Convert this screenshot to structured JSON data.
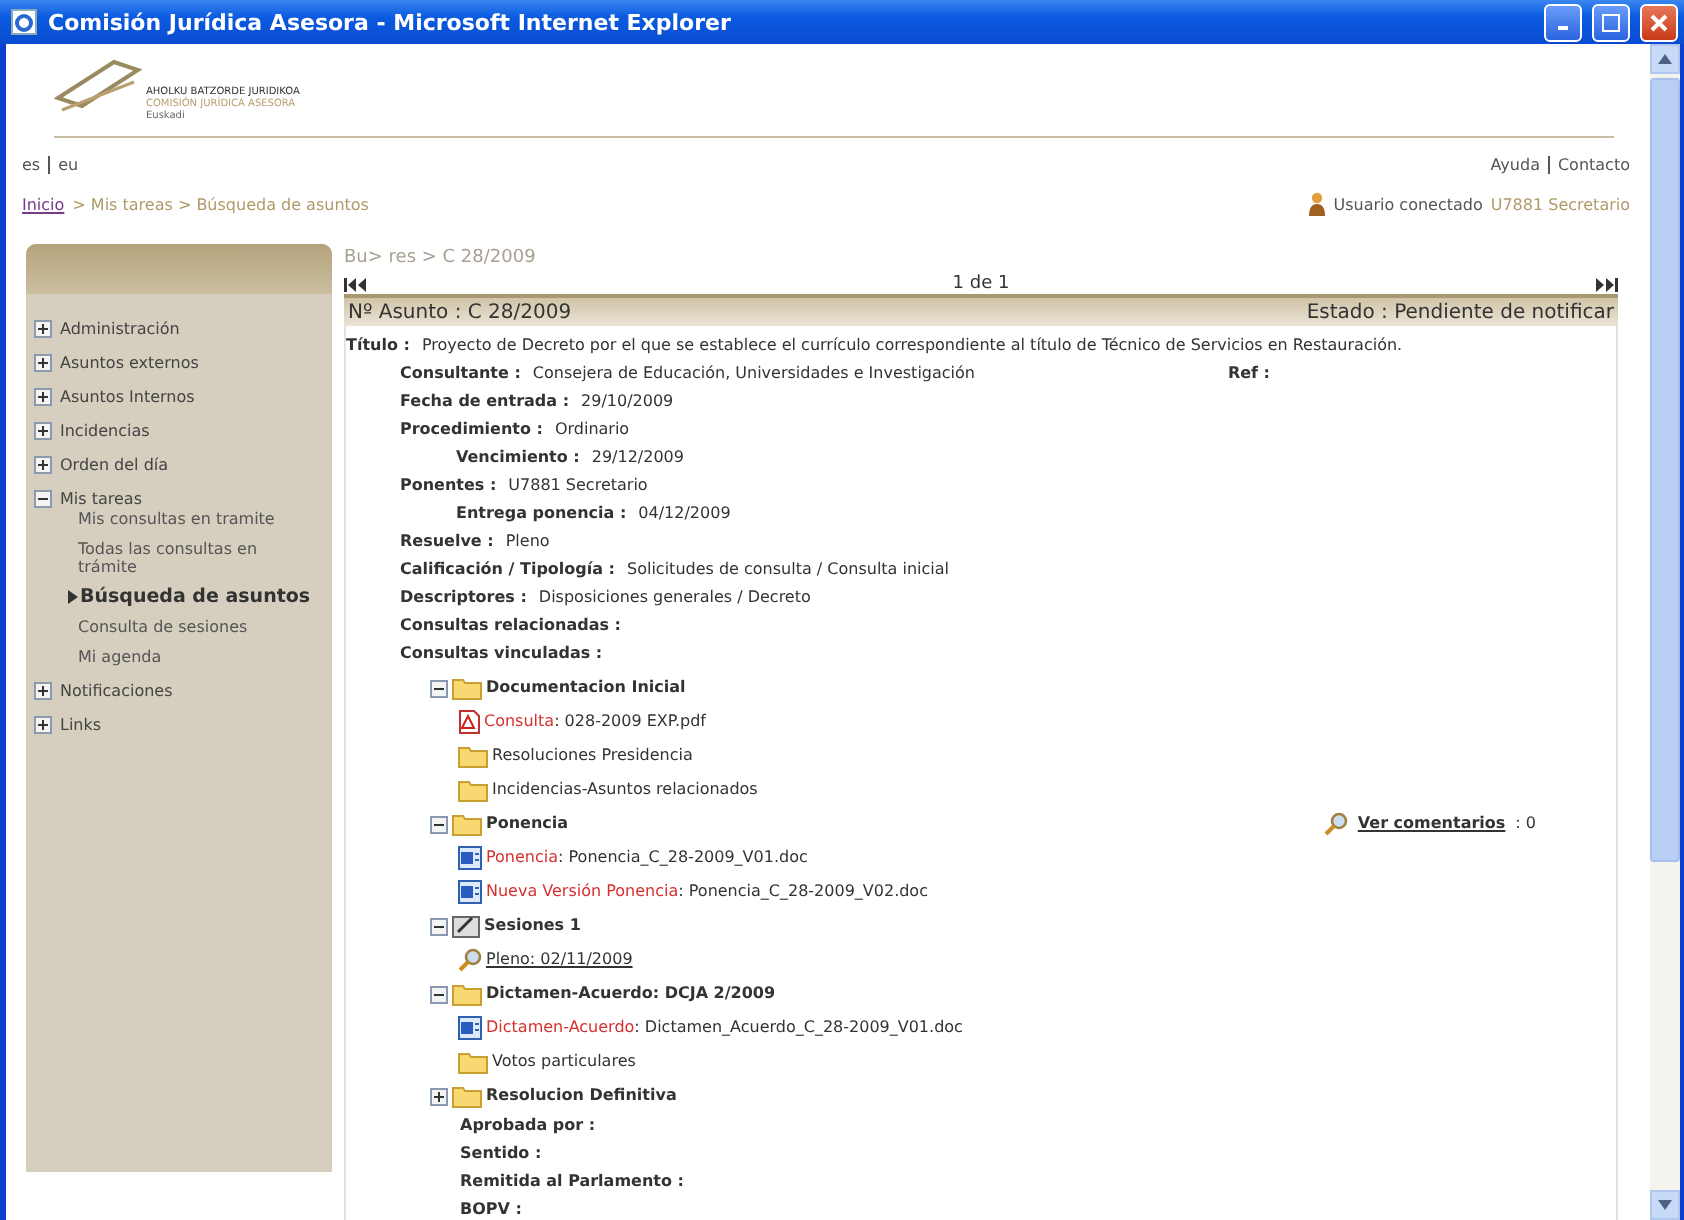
{
  "window": {
    "title": "Comisión Jurídica Asesora - Microsoft Internet Explorer"
  },
  "logo": {
    "lines": [
      "AHOLKU BATZORDE JURIDIKOA",
      "COMISIÓN JURÍDICA ASESORA",
      "Euskadi"
    ]
  },
  "languages": [
    "es",
    "eu"
  ],
  "top_links": [
    "Ayuda",
    "Contacto"
  ],
  "breadcrumb": {
    "home": "Inicio",
    "rest": "> Mis tareas > Búsqueda de asuntos"
  },
  "user": {
    "label": "Usuario conectado",
    "name": "U7881 Secretario"
  },
  "sidebar": {
    "items": [
      {
        "label": "Administración",
        "expanded": false
      },
      {
        "label": "Asuntos externos",
        "expanded": false
      },
      {
        "label": "Asuntos Internos",
        "expanded": false
      },
      {
        "label": "Incidencias",
        "expanded": false
      },
      {
        "label": "Orden del día",
        "expanded": false
      },
      {
        "label": "Mis tareas",
        "expanded": true,
        "children": [
          {
            "label": "Mis consultas en tramite",
            "selected": false
          },
          {
            "label": "Todas las consultas en trámite",
            "selected": false
          },
          {
            "label": "Búsqueda de asuntos",
            "selected": true
          },
          {
            "label": "Consulta de sesiones",
            "selected": false
          },
          {
            "label": "Mi agenda",
            "selected": false
          }
        ]
      },
      {
        "label": "Notificaciones",
        "expanded": false
      },
      {
        "label": "Links",
        "expanded": false
      }
    ]
  },
  "content": {
    "path": "Bu> res > C 28/2009",
    "pager": "1 de 1",
    "number": "Nº Asunto : C 28/2009",
    "status": "Estado : Pendiente de notificar",
    "title": {
      "label": "Título :",
      "value": "Proyecto de Decreto por el que se establece el currículo correspondiente al título de Técnico de Servicios en Restauración."
    },
    "fields": [
      {
        "label": "Consultante :",
        "value": "Consejera de Educación, Universidades e Investigación",
        "extra": "Ref :"
      },
      {
        "label": "Fecha de entrada :",
        "value": "29/10/2009"
      },
      {
        "label": "Procedimiento :",
        "value": "Ordinario",
        "children": [
          {
            "label": "Vencimiento :",
            "value": "29/12/2009"
          }
        ]
      },
      {
        "label": "Ponentes :",
        "value": "U7881 Secretario",
        "children": [
          {
            "label": "Entrega ponencia :",
            "value": "04/12/2009"
          }
        ]
      },
      {
        "label": "Resuelve :",
        "value": "Pleno"
      },
      {
        "label": "Calificación / Tipología :",
        "value": "Solicitudes de consulta / Consulta inicial"
      },
      {
        "label": "Descriptores :",
        "value": "Disposiciones generales / Decreto"
      },
      {
        "label": "Consultas relacionadas :"
      },
      {
        "label": "Consultas vinculadas :"
      }
    ],
    "tree": [
      {
        "kind": "folder",
        "label": "Documentacion Inicial",
        "expanded": true,
        "children": [
          {
            "kind": "pdf",
            "prefix": "Consulta",
            "name": ": 028-2009 EXP.pdf"
          },
          {
            "kind": "leaf",
            "label": "Resoluciones Presidencia"
          },
          {
            "kind": "leaf",
            "label": "Incidencias-Asuntos relacionados"
          }
        ]
      },
      {
        "kind": "folder",
        "label": "Ponencia",
        "expanded": true,
        "comments": {
          "link": "Ver comentarios",
          "count": ": 0"
        },
        "children": [
          {
            "kind": "doc",
            "prefix": "Ponencia",
            "name": ": Ponencia_C_28-2009_V01.doc"
          },
          {
            "kind": "doc",
            "prefix": "Nueva Versión Ponencia",
            "name": ": Ponencia_C_28-2009_V02.doc"
          }
        ]
      },
      {
        "kind": "session",
        "label": "Sesiones 1",
        "expanded": true,
        "children": [
          {
            "kind": "link",
            "label": "Pleno: 02/11/2009"
          }
        ]
      },
      {
        "kind": "folder",
        "label": "Dictamen-Acuerdo: DCJA 2/2009",
        "expanded": true,
        "children": [
          {
            "kind": "doc",
            "prefix": "Dictamen-Acuerdo",
            "name": ": Dictamen_Acuerdo_C_28-2009_V01.doc"
          },
          {
            "kind": "leaf",
            "label": "Votos particulares"
          }
        ]
      },
      {
        "kind": "folder",
        "label": "Resolucion Definitiva",
        "expanded": false
      }
    ],
    "closing_fields": [
      "Aprobada por :",
      "Sentido :",
      "Remitida al Parlamento :",
      "BOPV :"
    ]
  }
}
